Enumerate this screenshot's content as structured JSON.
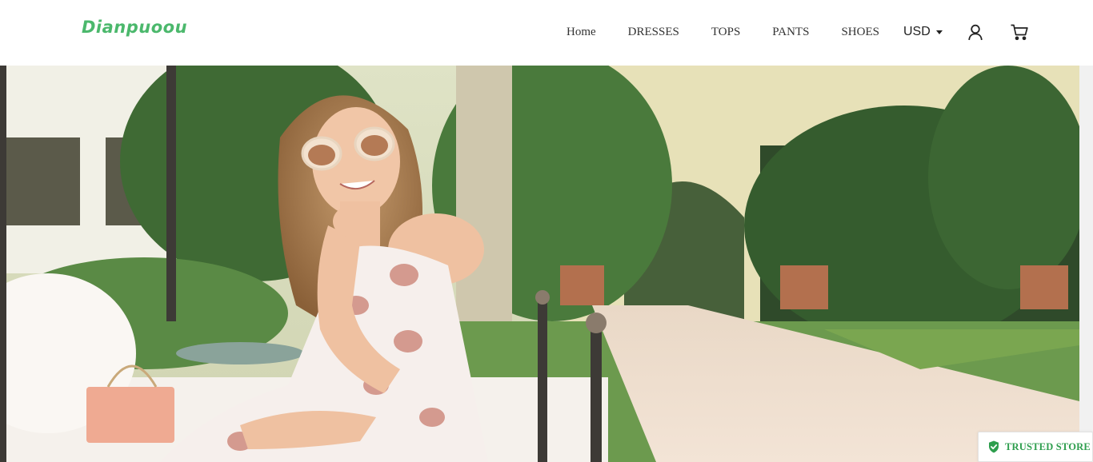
{
  "brand": {
    "logo_text": "Dianpuoou",
    "color": "#4bb86c"
  },
  "nav": {
    "items": [
      "Home",
      "DRESSES",
      "TOPS",
      "PANTS",
      "SHOES"
    ]
  },
  "currency": {
    "selected": "USD"
  },
  "icons": {
    "account": "user-icon",
    "cart": "cart-icon",
    "badge": "shield-check-icon"
  },
  "hero": {
    "alt": "Hero banner image"
  },
  "trust_badge": {
    "label": "TRUSTED STORE",
    "color": "#2e9e4e"
  }
}
